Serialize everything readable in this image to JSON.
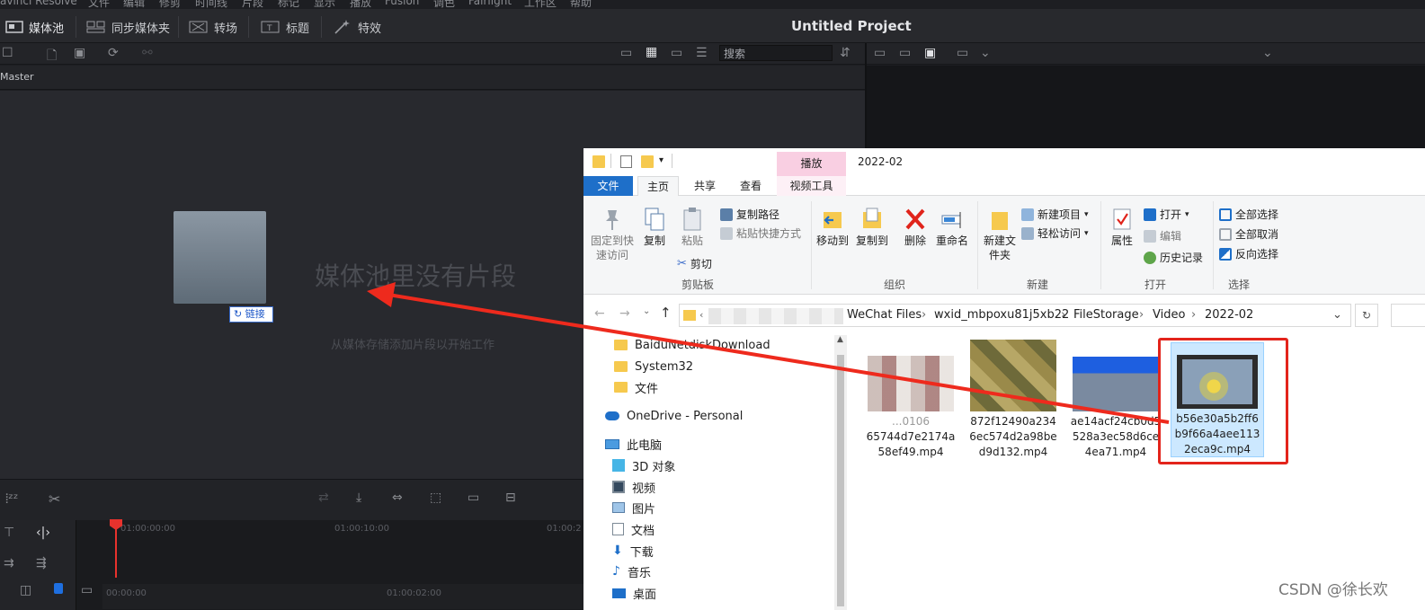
{
  "resolve": {
    "menu": [
      "avinci Resolve",
      "文件",
      "编辑",
      "修剪",
      "时间线",
      "片段",
      "标记",
      "显示",
      "播放",
      "Fusion",
      "调色",
      "Fairlight",
      "工作区",
      "帮助"
    ],
    "toolbar": {
      "media_pool": "媒体池",
      "sync_bin": "同步媒体夹",
      "transitions": "转场",
      "titles": "标题",
      "effects": "特效"
    },
    "project_title": "Untitled Project",
    "search_placeholder": "搜索",
    "bin_name": "Master",
    "empty_title": "媒体池里没有片段",
    "empty_hint": "从媒体存储添加片段以开始工作",
    "link_label": "链接",
    "timecodes": {
      "t1": "01:00:00:00",
      "t2": "01:00:10:00",
      "t3": "01:00:2",
      "t4": "00:00:00",
      "t5": "01:00:02:00"
    }
  },
  "explorer": {
    "title": "2022-02",
    "play_tab": "播放",
    "tabs": {
      "file": "文件",
      "home": "主页",
      "share": "共享",
      "view": "查看",
      "video_tools": "视频工具"
    },
    "ribbon": {
      "clipboard": {
        "label": "剪贴板",
        "pin": "固定到快速访问",
        "copy": "复制",
        "paste": "粘贴",
        "copy_path": "复制路径",
        "paste_shortcut": "粘贴快捷方式",
        "cut": "剪切"
      },
      "organize": {
        "label": "组织",
        "move_to": "移动到",
        "copy_to": "复制到",
        "delete": "删除",
        "rename": "重命名"
      },
      "new": {
        "label": "新建",
        "new_folder": "新建文件夹",
        "new_item": "新建项目",
        "easy_access": "轻松访问"
      },
      "open": {
        "label": "打开",
        "properties": "属性",
        "open": "打开",
        "edit": "编辑",
        "history": "历史记录"
      },
      "select": {
        "label": "选择",
        "select_all": "全部选择",
        "select_none": "全部取消",
        "invert": "反向选择"
      }
    },
    "address": {
      "path": [
        "WeChat Files",
        "wxid_mbpoxu81j5xb22",
        "FileStorage",
        "Video",
        "2022-02"
      ]
    },
    "nav": [
      "BaiduNetdiskDownload",
      "System32",
      "文件",
      "OneDrive - Personal",
      "此电脑",
      "3D 对象",
      "视频",
      "图片",
      "文档",
      "下载",
      "音乐",
      "桌面"
    ],
    "files": [
      {
        "name": "...c106 65744d7e2174a 58ef49.mp4",
        "line1": "...0106",
        "line2": "65744d7e2174a",
        "line3": "58ef49.mp4"
      },
      {
        "name": "872f12490a234 6ec574d2a98be d9d132.mp4",
        "line1": "872f12490a234",
        "line2": "6ec574d2a98be",
        "line3": "d9d132.mp4"
      },
      {
        "name": "ae14acf24cb0d5 528a3ec58d6ce 4ea71.mp4",
        "line1": "ae14acf24cb0d5",
        "line2": "528a3ec58d6ce",
        "line3": "4ea71.mp4"
      },
      {
        "name": "b56e30a5b2ff6 b9f66a4aee113 2eca9c.mp4",
        "line1": "b56e30a5b2ff6",
        "line2": "b9f66a4aee113",
        "line3": "2eca9c.mp4"
      }
    ]
  },
  "watermark": "CSDN @徐长欢",
  "colors": {
    "resolve_bg": "#28292e",
    "accent_red": "#e3241b",
    "explorer_blue": "#1e6fc9",
    "select_bg": "#cce8ff"
  }
}
